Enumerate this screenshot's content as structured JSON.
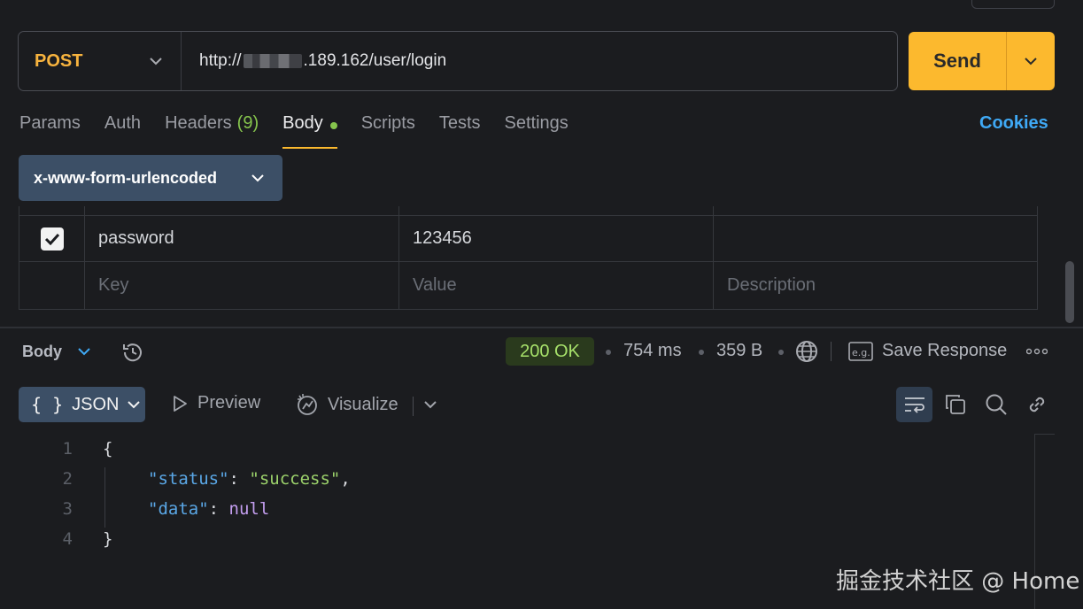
{
  "request": {
    "method": "POST",
    "url_prefix": "http://",
    "url_suffix": ".189.162/user/login",
    "send_label": "Send"
  },
  "tabs": [
    {
      "label": "Params"
    },
    {
      "label": "Auth"
    },
    {
      "label": "Headers",
      "count": "(9)"
    },
    {
      "label": "Body",
      "active": true
    },
    {
      "label": "Scripts"
    },
    {
      "label": "Tests"
    },
    {
      "label": "Settings"
    }
  ],
  "cookies_label": "Cookies",
  "body_type": "x-www-form-urlencoded",
  "params": {
    "rows": [
      {
        "checked": true,
        "key": "password",
        "value": "123456",
        "description": ""
      }
    ],
    "placeholder": {
      "key": "Key",
      "value": "Value",
      "description": "Description"
    }
  },
  "response": {
    "body_label": "Body",
    "status": "200 OK",
    "time": "754 ms",
    "size": "359 B",
    "save_label": "Save Response",
    "format": "JSON",
    "preview_label": "Preview",
    "visualize_label": "Visualize",
    "code_lines": [
      "1",
      "2",
      "3",
      "4"
    ],
    "json": {
      "open": "{",
      "status_key": "\"status\"",
      "status_value": "\"success\"",
      "data_key": "\"data\"",
      "data_value": "null",
      "close": "}"
    }
  },
  "watermark": "掘金技术社区 @ Home",
  "colors": {
    "accent": "#fcb92e",
    "method": "#f7b33e",
    "link": "#3fa9f5",
    "success": "#a6e06a",
    "tab_count": "#86c54d"
  }
}
